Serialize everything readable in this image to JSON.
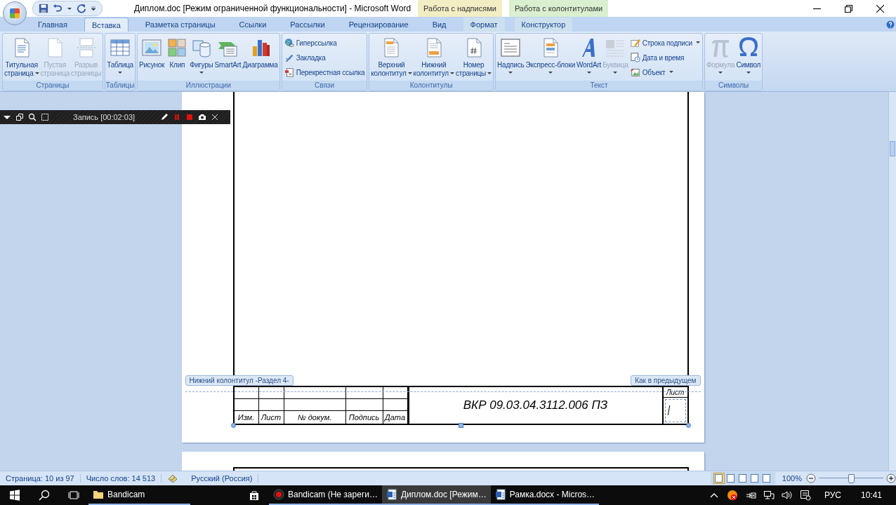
{
  "title_bar": {
    "title": "Диплом.doc [Режим ограниченной функциональности] - Microsoft Word",
    "contextual_groups": [
      {
        "label": "Работа с надписями",
        "color": "#f3edc4"
      },
      {
        "label": "Работа с колонтитулами",
        "color": "#d9efcf"
      }
    ]
  },
  "tabs": [
    {
      "label": "Главная",
      "selected": false,
      "kind": "standard"
    },
    {
      "label": "Вставка",
      "selected": true,
      "kind": "standard"
    },
    {
      "label": "Разметка страницы",
      "selected": false,
      "kind": "standard"
    },
    {
      "label": "Ссылки",
      "selected": false,
      "kind": "standard"
    },
    {
      "label": "Рассылки",
      "selected": false,
      "kind": "standard"
    },
    {
      "label": "Рецензирование",
      "selected": false,
      "kind": "standard"
    },
    {
      "label": "Вид",
      "selected": false,
      "kind": "standard"
    },
    {
      "label": "Формат",
      "selected": false,
      "kind": "contextual"
    },
    {
      "label": "Конструктор",
      "selected": false,
      "kind": "contextual"
    }
  ],
  "ribbon": {
    "groups": [
      {
        "label": "Страницы",
        "items": [
          {
            "kind": "large",
            "lines": [
              "Титульная",
              "страница"
            ],
            "dropdown": true,
            "disabled": false
          },
          {
            "kind": "large",
            "lines": [
              "Пустая",
              "страница"
            ],
            "dropdown": false,
            "disabled": true
          },
          {
            "kind": "large",
            "lines": [
              "Разрыв",
              "страницы"
            ],
            "dropdown": false,
            "disabled": true
          }
        ]
      },
      {
        "label": "Таблицы",
        "items": [
          {
            "kind": "large",
            "lines": [
              "Таблица"
            ],
            "dropdown": true,
            "disabled": false
          }
        ]
      },
      {
        "label": "Иллюстрации",
        "items": [
          {
            "kind": "large",
            "lines": [
              "Рисунок"
            ],
            "dropdown": false,
            "disabled": false
          },
          {
            "kind": "large",
            "lines": [
              "Клип"
            ],
            "dropdown": false,
            "disabled": false
          },
          {
            "kind": "large",
            "lines": [
              "Фигуры"
            ],
            "dropdown": true,
            "disabled": false
          },
          {
            "kind": "large",
            "lines": [
              "SmartArt"
            ],
            "dropdown": false,
            "disabled": false
          },
          {
            "kind": "large",
            "lines": [
              "Диаграмма"
            ],
            "dropdown": false,
            "disabled": false
          }
        ]
      },
      {
        "label": "Связи",
        "items": [
          {
            "kind": "small",
            "lines": [
              "Гиперссылка"
            ],
            "dropdown": false,
            "disabled": false
          },
          {
            "kind": "small",
            "lines": [
              "Закладка"
            ],
            "dropdown": false,
            "disabled": false
          },
          {
            "kind": "small",
            "lines": [
              "Перекрестная ссылка"
            ],
            "dropdown": false,
            "disabled": false
          }
        ]
      },
      {
        "label": "Колонтитулы",
        "items": [
          {
            "kind": "large",
            "lines": [
              "Верхний",
              "колонтитул"
            ],
            "dropdown": true,
            "disabled": false
          },
          {
            "kind": "large",
            "lines": [
              "Нижний",
              "колонтитул"
            ],
            "dropdown": true,
            "disabled": false
          },
          {
            "kind": "large",
            "lines": [
              "Номер",
              "страницы"
            ],
            "dropdown": true,
            "disabled": false
          }
        ]
      },
      {
        "label": "Текст",
        "items": [
          {
            "kind": "large",
            "lines": [
              "Надпись"
            ],
            "dropdown": true,
            "disabled": false
          },
          {
            "kind": "large",
            "lines": [
              "Экспресс-блоки"
            ],
            "dropdown": true,
            "disabled": false
          },
          {
            "kind": "large",
            "lines": [
              "WordArt"
            ],
            "dropdown": true,
            "disabled": false
          },
          {
            "kind": "large",
            "lines": [
              "Буквица"
            ],
            "dropdown": true,
            "disabled": true
          },
          {
            "kind": "small",
            "lines": [
              "Строка подписи"
            ],
            "dropdown": true,
            "disabled": false
          },
          {
            "kind": "small",
            "lines": [
              "Дата и время"
            ],
            "dropdown": false,
            "disabled": false
          },
          {
            "kind": "small",
            "lines": [
              "Объект"
            ],
            "dropdown": true,
            "disabled": false
          }
        ]
      },
      {
        "label": "Символы",
        "items": [
          {
            "kind": "large",
            "lines": [
              "Формула"
            ],
            "dropdown": true,
            "disabled": true
          },
          {
            "kind": "large",
            "lines": [
              "Символ"
            ],
            "dropdown": true,
            "disabled": false
          }
        ]
      }
    ]
  },
  "recorder_bar": {
    "title": "Запись [00:02:03]"
  },
  "document": {
    "footer_tag": "Нижний колонтитул -Раздел 4-",
    "link_tag": "Как в предыдущем",
    "title_block": {
      "headers": [
        "Изм.",
        "Лист",
        "№ докум.",
        "Подпись",
        "Дата"
      ],
      "code": "ВКР 09.03.04.3112.006 ПЗ",
      "sheet_label": "Лист"
    }
  },
  "status_bar": {
    "page": "Страница: 10 из 97",
    "words": "Число слов: 14 513",
    "language": "Русский (Россия)",
    "views": [
      {
        "selected": true
      },
      {
        "selected": false
      },
      {
        "selected": false
      },
      {
        "selected": false
      },
      {
        "selected": false
      }
    ],
    "zoom": "100%",
    "zoom_slider": {
      "level": 0.5
    }
  },
  "taskbar": {
    "items": [
      {
        "label": "Bandicam",
        "selected": false
      },
      {
        "label": "Bandicam (Не зареги…",
        "selected": false
      },
      {
        "label": "Диплом.doc [Режим…",
        "selected": true
      },
      {
        "label": "Рамка.docx - Micros…",
        "selected": false
      }
    ],
    "language": "РУС",
    "time": "10:41"
  }
}
